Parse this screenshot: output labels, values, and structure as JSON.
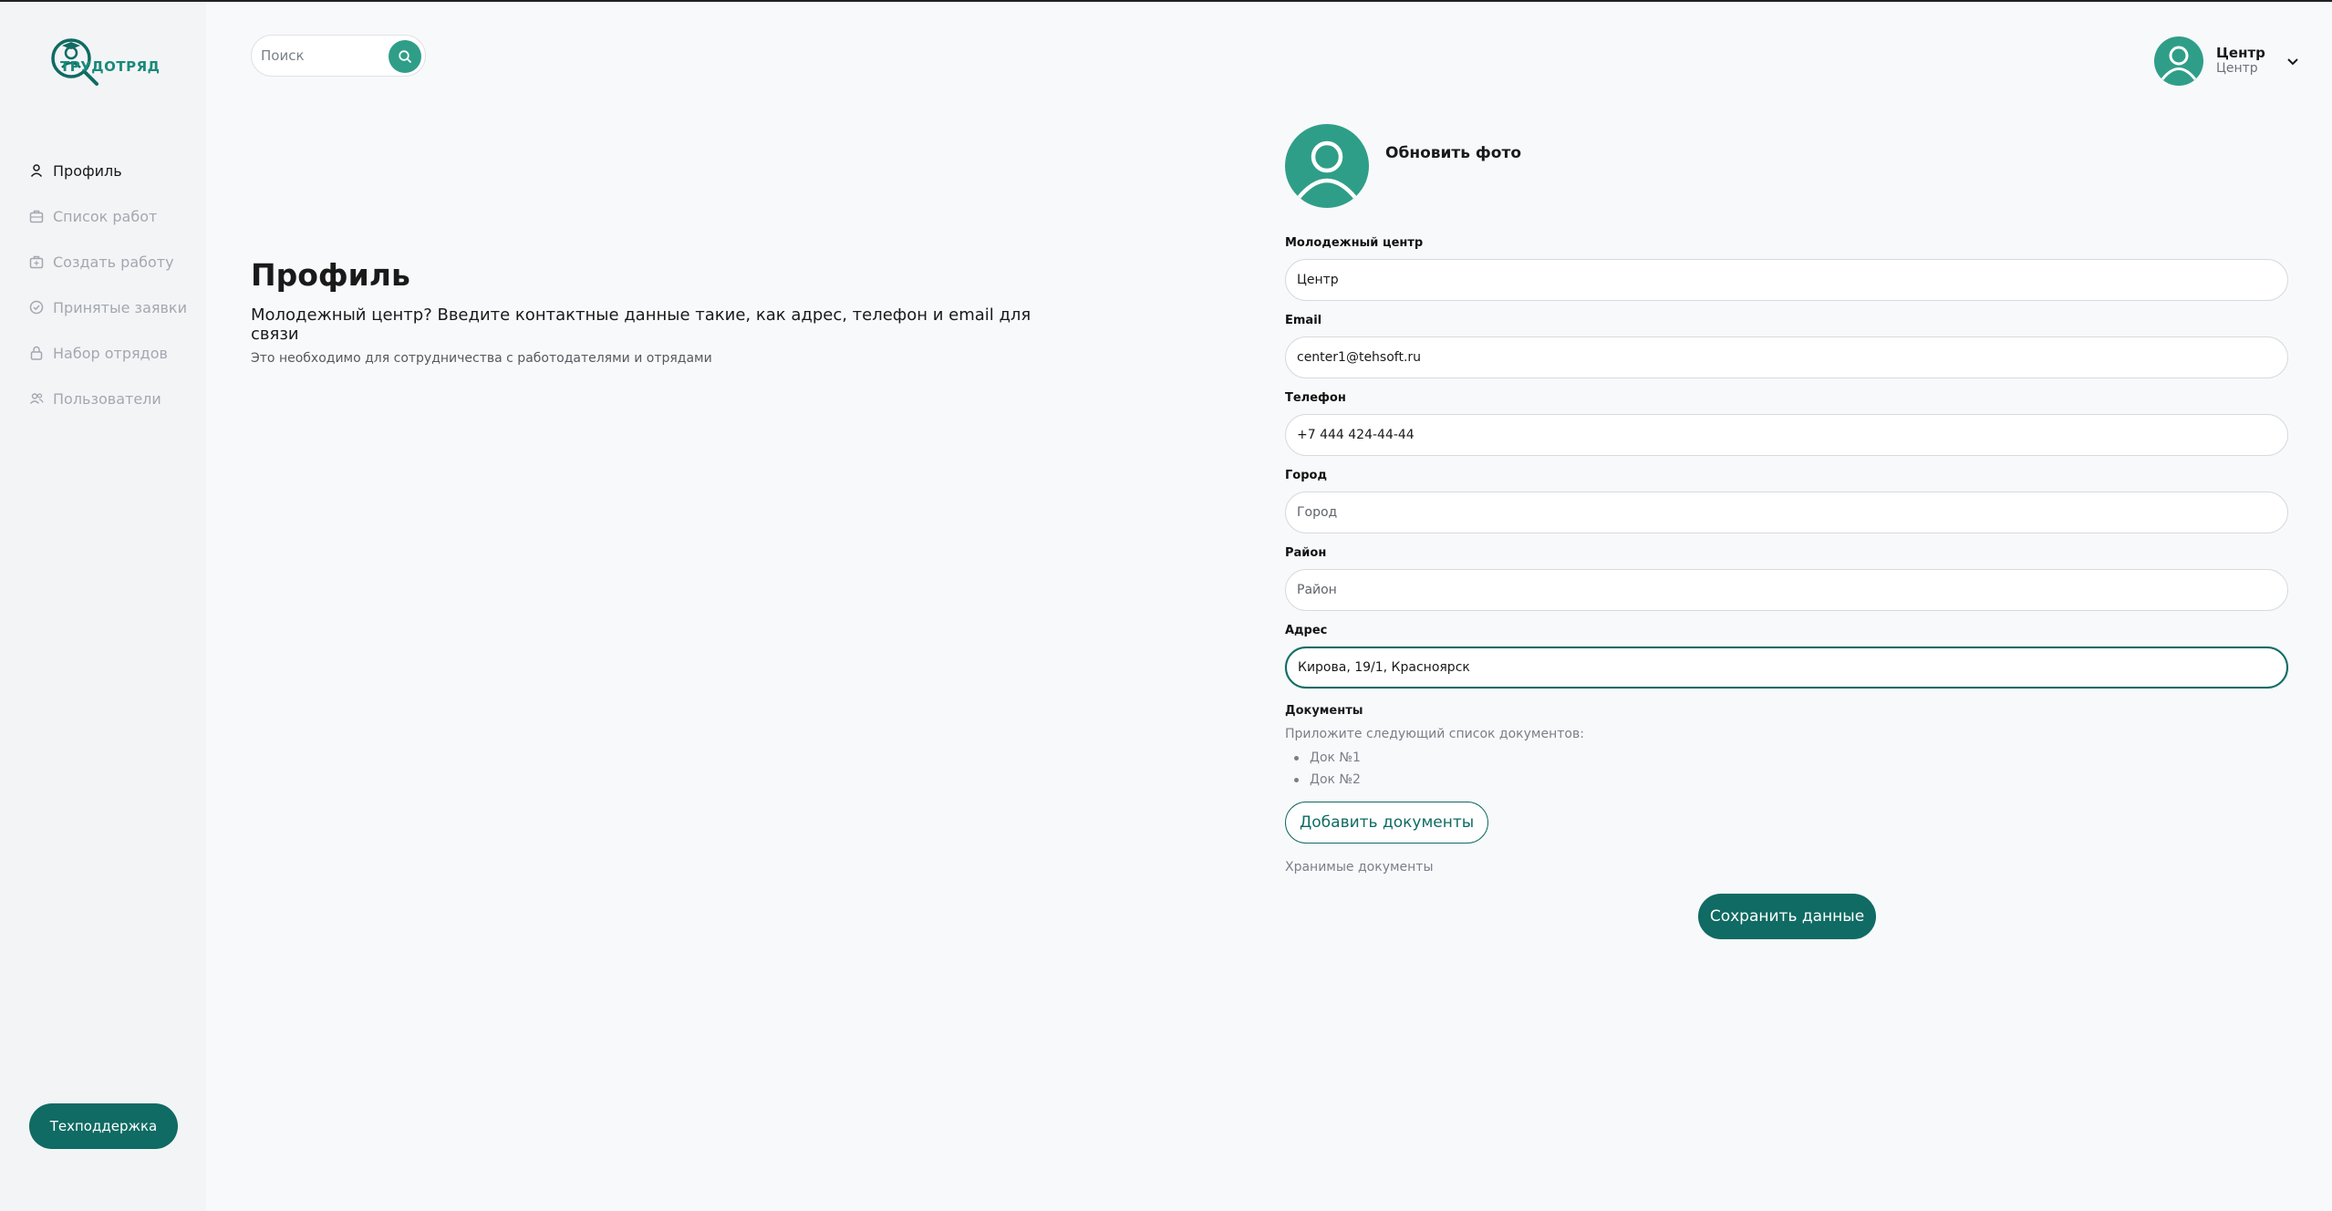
{
  "app": {
    "logo_text": "ТРУДОТРЯД"
  },
  "colors": {
    "accent": "#0f6b63",
    "accent_light": "#2f9e88",
    "background": "#f8f9fb",
    "sidebar": "#f3f4f6"
  },
  "search": {
    "placeholder": "Поиск",
    "icon": "search-icon"
  },
  "user": {
    "name": "Центр",
    "role": "Центр",
    "icon": "user-icon"
  },
  "sidebar": {
    "items": [
      {
        "label": "Профиль",
        "icon": "user-icon",
        "active": true
      },
      {
        "label": "Список работ",
        "icon": "briefcase-icon",
        "active": false
      },
      {
        "label": "Создать работу",
        "icon": "briefcase-plus-icon",
        "active": false
      },
      {
        "label": "Принятые заявки",
        "icon": "check-circle-icon",
        "active": false
      },
      {
        "label": "Набор отрядов",
        "icon": "lock-icon",
        "active": false
      },
      {
        "label": "Пользователи",
        "icon": "users-icon",
        "active": false
      }
    ],
    "support_label": "Техподдержка"
  },
  "intro": {
    "title": "Профиль",
    "question": "Молодежный центр? Введите контактные данные такие, как адрес, телефон и email для связи",
    "hint": "Это необходимо для сотрудничества с работодателями и отрядами"
  },
  "photo": {
    "label": "Обновить фото"
  },
  "form": {
    "fields": [
      {
        "label": "Молодежный центр",
        "value": "Центр",
        "placeholder": ""
      },
      {
        "label": "Email",
        "value": "center1@tehsoft.ru",
        "placeholder": ""
      },
      {
        "label": "Телефон",
        "value": "+7 444 424-44-44",
        "placeholder": ""
      },
      {
        "label": "Город",
        "value": "",
        "placeholder": "Город"
      },
      {
        "label": "Район",
        "value": "",
        "placeholder": "Район"
      },
      {
        "label": "Адрес",
        "value": "Кирова, 19/1, Красноярск",
        "placeholder": ""
      }
    ],
    "documents": {
      "title": "Документы",
      "hint": "Приложите следующий список документов:",
      "items": [
        "Док №1",
        "Док №2"
      ],
      "add_label": "Добавить документы",
      "stored_label": "Хранимые документы"
    },
    "save_label": "Сохранить данные"
  }
}
